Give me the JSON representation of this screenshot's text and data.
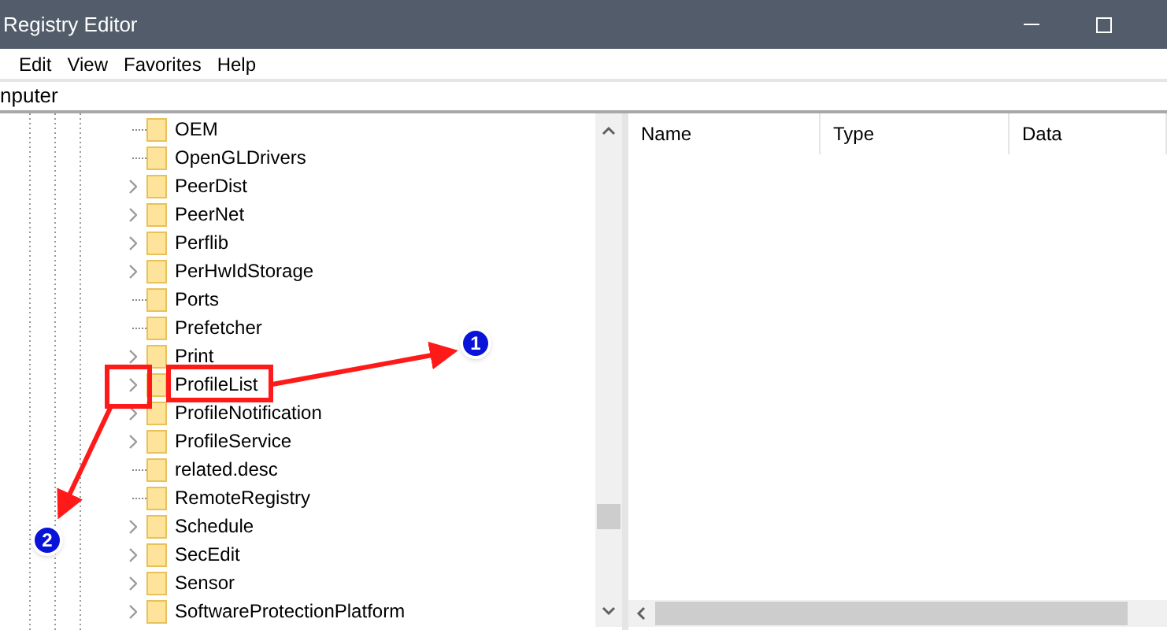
{
  "window": {
    "title": "Registry Editor"
  },
  "menu": [
    {
      "label": "Edit"
    },
    {
      "label": "View"
    },
    {
      "label": "Favorites"
    },
    {
      "label": "Help"
    }
  ],
  "address_bar": {
    "value": "nputer"
  },
  "tree": [
    {
      "label": "OEM",
      "kind": "leaf"
    },
    {
      "label": "OpenGLDrivers",
      "kind": "leaf"
    },
    {
      "label": "PeerDist",
      "kind": "expandable"
    },
    {
      "label": "PeerNet",
      "kind": "expandable"
    },
    {
      "label": "Perflib",
      "kind": "expandable"
    },
    {
      "label": "PerHwIdStorage",
      "kind": "expandable"
    },
    {
      "label": "Ports",
      "kind": "leaf"
    },
    {
      "label": "Prefetcher",
      "kind": "leaf"
    },
    {
      "label": "Print",
      "kind": "expandable"
    },
    {
      "label": "ProfileList",
      "kind": "expandable"
    },
    {
      "label": "ProfileNotification",
      "kind": "expandable"
    },
    {
      "label": "ProfileService",
      "kind": "expandable"
    },
    {
      "label": "related.desc",
      "kind": "leaf"
    },
    {
      "label": "RemoteRegistry",
      "kind": "leaf"
    },
    {
      "label": "Schedule",
      "kind": "expandable"
    },
    {
      "label": "SecEdit",
      "kind": "expandable"
    },
    {
      "label": "Sensor",
      "kind": "expandable"
    },
    {
      "label": "SoftwareProtectionPlatform",
      "kind": "expandable"
    }
  ],
  "table": {
    "columns": [
      "Name",
      "Type",
      "Data"
    ]
  },
  "annotations": [
    {
      "label": "1"
    },
    {
      "label": "2"
    }
  ]
}
